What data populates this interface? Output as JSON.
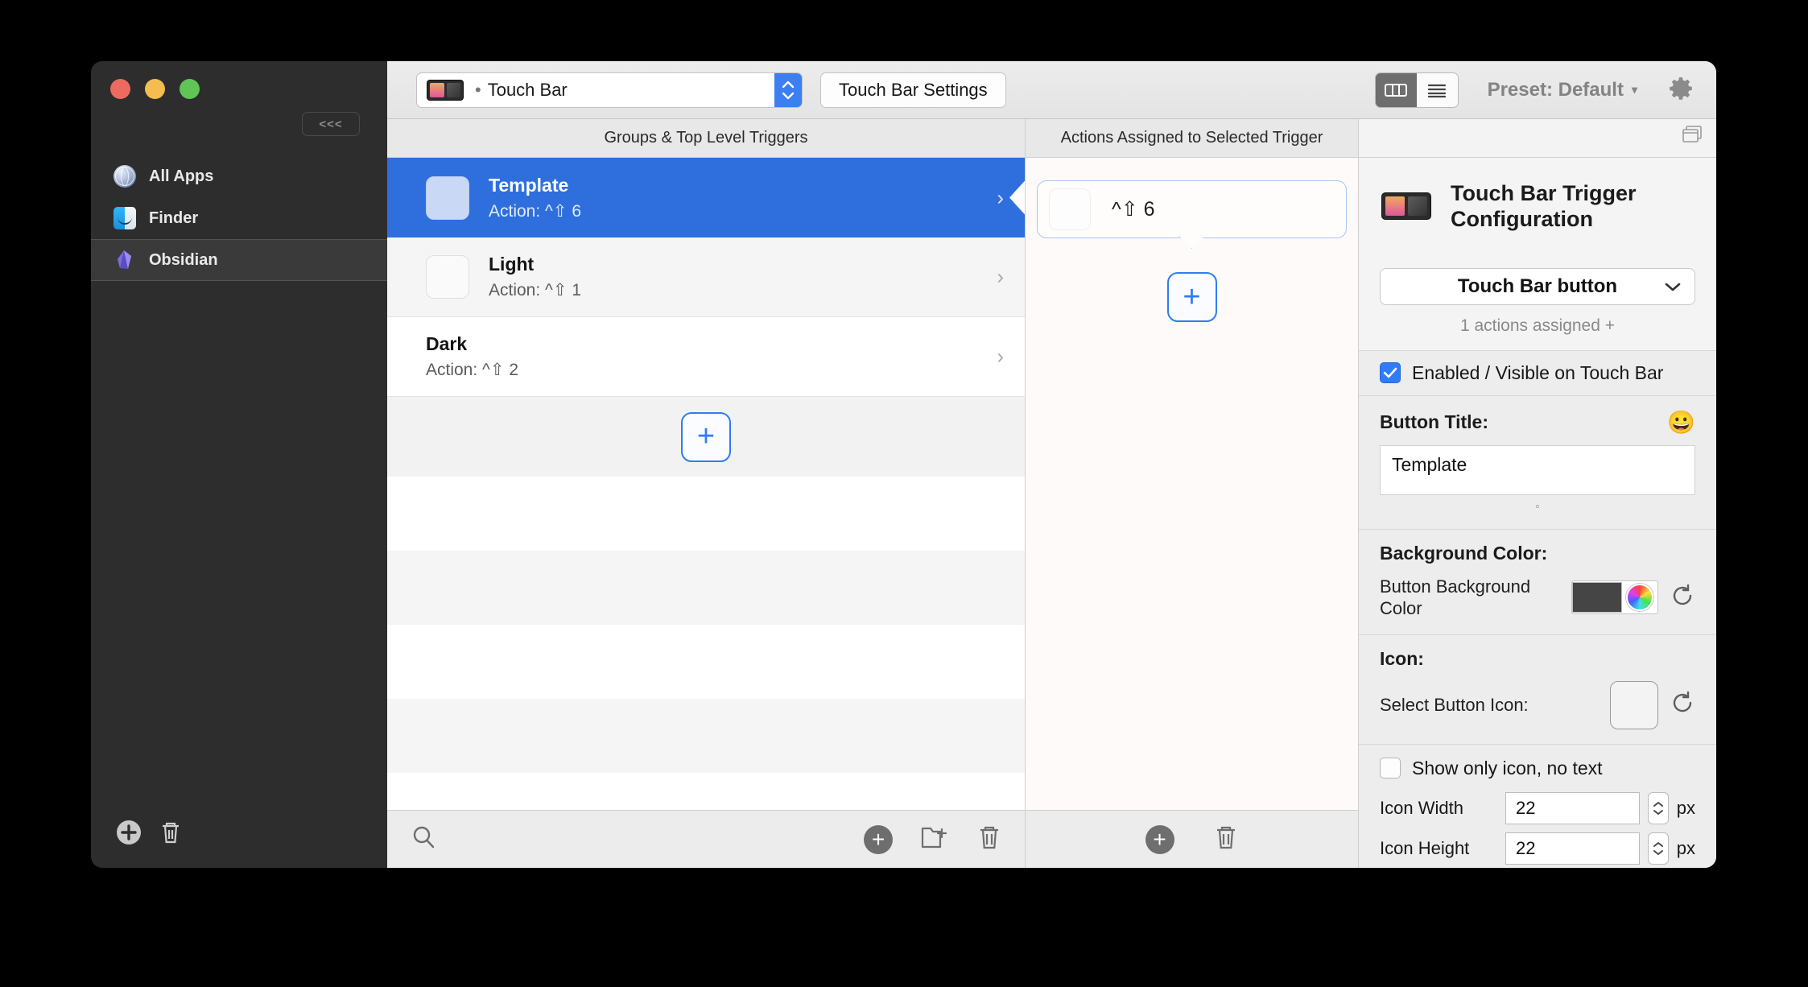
{
  "sidebar": {
    "collapse_label": "<<<",
    "items": [
      {
        "label": "All Apps",
        "icon": "globe-icon"
      },
      {
        "label": "Finder",
        "icon": "finder-icon"
      },
      {
        "label": "Obsidian",
        "icon": "obsidian-icon"
      }
    ],
    "bottom": {
      "add": "add-icon",
      "delete": "trash-icon"
    }
  },
  "toolbar": {
    "device_selector_value": "Touch Bar",
    "device_bullet": "•",
    "settings_button": "Touch Bar Settings",
    "view_grid": "columns-view-icon",
    "view_list": "list-view-icon",
    "preset_label": "Preset: Default",
    "preset_caret": "▾",
    "gear": "gear-icon"
  },
  "columns": {
    "groups_header": "Groups & Top Level Triggers",
    "actions_header": "Actions Assigned to Selected Trigger"
  },
  "groups": {
    "rows": [
      {
        "title": "Template",
        "subtitle": "Action: ^⇧ 6",
        "selected": true
      },
      {
        "title": "Light",
        "subtitle": "Action: ^⇧ 1",
        "selected": false
      },
      {
        "title": "Dark",
        "subtitle": "Action: ^⇧ 2",
        "selected": false
      }
    ],
    "add_label": "+",
    "bottom": {
      "search": "search-icon",
      "add": "add-icon",
      "new_group": "new-folder-icon",
      "delete": "trash-icon"
    }
  },
  "actions": {
    "items": [
      {
        "label": "^⇧ 6"
      }
    ],
    "add_label": "+",
    "bottom": {
      "add": "add-icon",
      "delete": "trash-icon"
    }
  },
  "inspector": {
    "window_icon": "windows-icon",
    "title": "Touch Bar Trigger Configuration",
    "type_dropdown": "Touch Bar button",
    "type_caret": "⌄",
    "assigned_text": "1 actions assigned +",
    "enabled_label": "Enabled / Visible on Touch Bar",
    "enabled_checked": true,
    "button_title_label": "Button Title:",
    "emoji_picker": "😀",
    "button_title_value": "Template",
    "background_color_label": "Background Color:",
    "button_bg_label": "Button Background Color",
    "button_bg_color": "#454545",
    "icon_section_label": "Icon:",
    "select_icon_label": "Select Button Icon:",
    "show_only_icon_label": "Show only icon, no text",
    "show_only_icon_checked": false,
    "icon_width_label": "Icon Width",
    "icon_width_value": "22",
    "icon_height_label": "Icon Height",
    "icon_height_value": "22",
    "unit": "px"
  }
}
